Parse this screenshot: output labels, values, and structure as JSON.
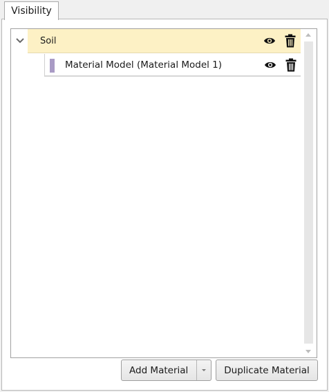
{
  "tabs": [
    {
      "label": "Visibility",
      "active": true
    }
  ],
  "tree": {
    "parent": {
      "label": "Soil",
      "expanded": true,
      "background": "#fdf1c5",
      "icons": [
        "eye-icon",
        "trash-icon"
      ]
    },
    "children": [
      {
        "label": "Material Model (Material Model 1)",
        "swatch_color": "#a99bc5",
        "icons": [
          "eye-icon",
          "trash-icon"
        ]
      }
    ]
  },
  "buttons": {
    "add_material": "Add Material",
    "duplicate_material": "Duplicate Material"
  }
}
